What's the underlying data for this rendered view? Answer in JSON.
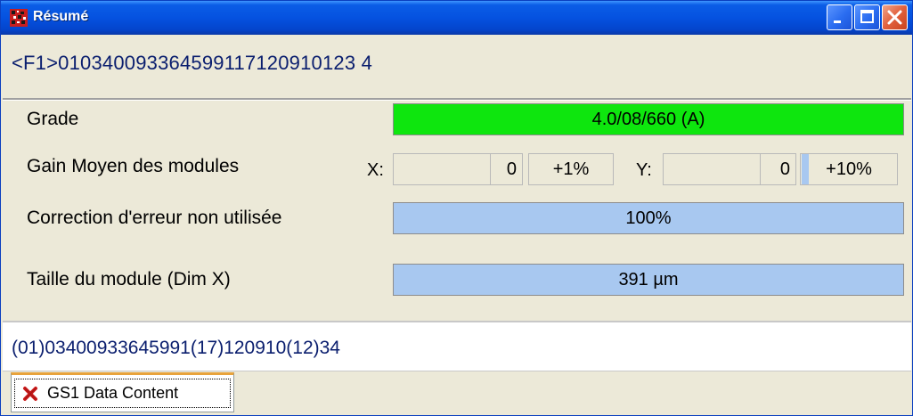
{
  "window": {
    "title": "Résumé"
  },
  "header": {
    "code": "<F1>010340093364599117120910123 4"
  },
  "rows": {
    "grade": {
      "label": "Grade",
      "value": "4.0/08/660 (A)",
      "color": "#0ee60e"
    },
    "gain": {
      "label": "Gain Moyen des modules",
      "x_label": "X:",
      "x_value": "0",
      "x_pct": "+1%",
      "y_label": "Y:",
      "y_value": "0",
      "y_pct": "+10%"
    },
    "error_correction": {
      "label": "Correction d'erreur non utilisée",
      "value": "100%"
    },
    "module_size": {
      "label": "Taille du module (Dim X)",
      "value": "391 µm"
    }
  },
  "gs1": {
    "content": "(01)03400933645991(17)120910(12)34"
  },
  "tabs": [
    {
      "label": "GS1 Data Content",
      "icon": "red-x-icon"
    }
  ],
  "colors": {
    "bar_blue": "#a8c8f0",
    "titlebar": "#0552e0",
    "text_navy": "#0a1e6e"
  }
}
